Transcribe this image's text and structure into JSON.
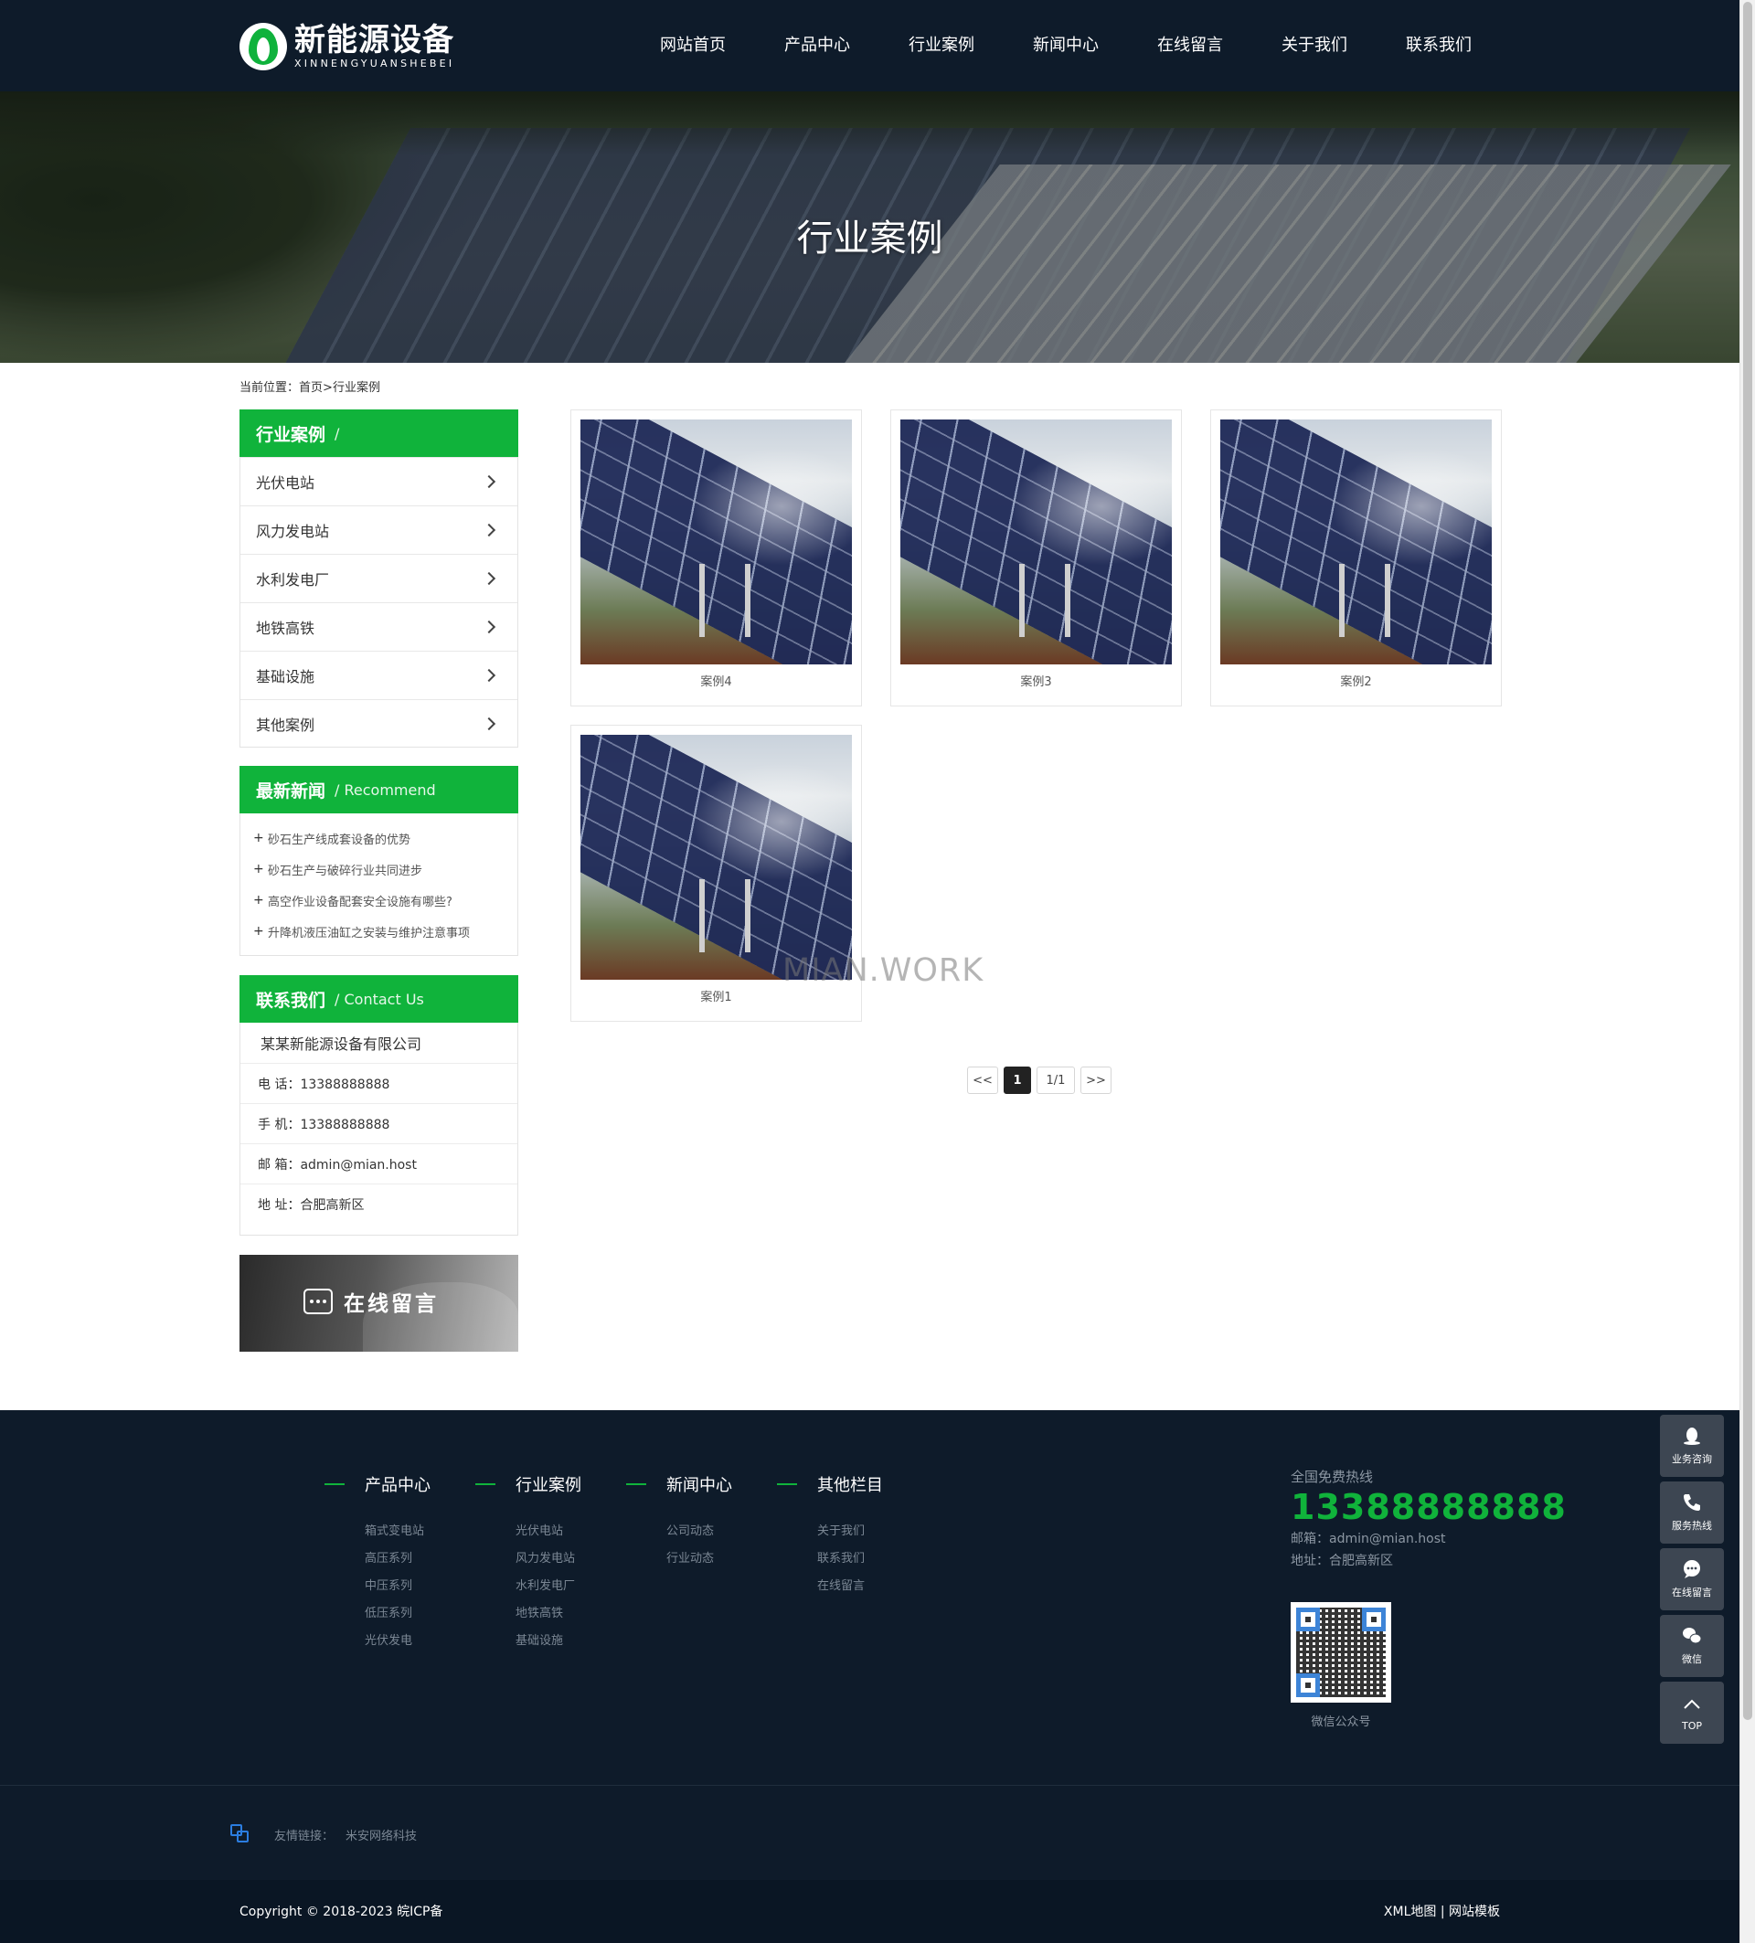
{
  "header": {
    "logo_cn": "新能源设备",
    "logo_en": "XINNENGYUANSHEBEI",
    "nav": [
      "网站首页",
      "产品中心",
      "行业案例",
      "新闻中心",
      "在线留言",
      "关于我们",
      "联系我们"
    ]
  },
  "banner": {
    "title": "行业案例"
  },
  "breadcrumb": {
    "prefix": "当前位置：",
    "home": "首页",
    "sep": ">",
    "current": "行业案例"
  },
  "sidebar": {
    "categories": {
      "title": "行业案例",
      "sub": "/",
      "items": [
        "光伏电站",
        "风力发电站",
        "水利发电厂",
        "地铁高铁",
        "基础设施",
        "其他案例"
      ]
    },
    "news": {
      "title": "最新新闻",
      "sub": "/ Recommend",
      "items": [
        "砂石生产线成套设备的优势",
        "砂石生产与破碎行业共同进步",
        "高空作业设备配套安全设施有哪些?",
        "升降机液压油缸之安装与维护注意事项"
      ]
    },
    "contact": {
      "title": "联系我们",
      "sub": "/ Contact Us",
      "company": "某某新能源设备有限公司",
      "rows": [
        "电 话：13388888888",
        "手 机：13388888888",
        "邮 箱：admin@mian.host",
        "地 址：合肥高新区"
      ]
    },
    "message_banner": "在线留言"
  },
  "cases": [
    "案例4",
    "案例3",
    "案例2",
    "案例1"
  ],
  "watermark": "MIAN.WORK",
  "pager": {
    "prev": "<<",
    "current": "1",
    "info": "1/1",
    "next": ">>"
  },
  "footer": {
    "columns": [
      {
        "title": "产品中心",
        "links": [
          "箱式变电站",
          "高压系列",
          "中压系列",
          "低压系列",
          "光伏发电"
        ]
      },
      {
        "title": "行业案例",
        "links": [
          "光伏电站",
          "风力发电站",
          "水利发电厂",
          "地铁高铁",
          "基础设施"
        ]
      },
      {
        "title": "新闻中心",
        "links": [
          "公司动态",
          "行业动态"
        ]
      },
      {
        "title": "其他栏目",
        "links": [
          "关于我们",
          "联系我们",
          "在线留言"
        ]
      }
    ],
    "hotline_label": "全国免费热线",
    "hotline": "13388888888",
    "email": "邮箱：admin@mian.host",
    "address": "地址：合肥高新区",
    "qr_label": "微信公众号",
    "friend_label": "友情链接：",
    "friend_links": [
      "米安网络科技"
    ],
    "copyright": "Copyright © 2018-2023 皖ICP备",
    "right_links": "XML地图 | 网站模板"
  },
  "float_bar": [
    "业务咨询",
    "服务热线",
    "在线留言",
    "微信",
    "TOP"
  ],
  "colors": {
    "accent": "#10b33b",
    "header_bg": "#0e1b2a",
    "float_bg": "#3d4652"
  }
}
